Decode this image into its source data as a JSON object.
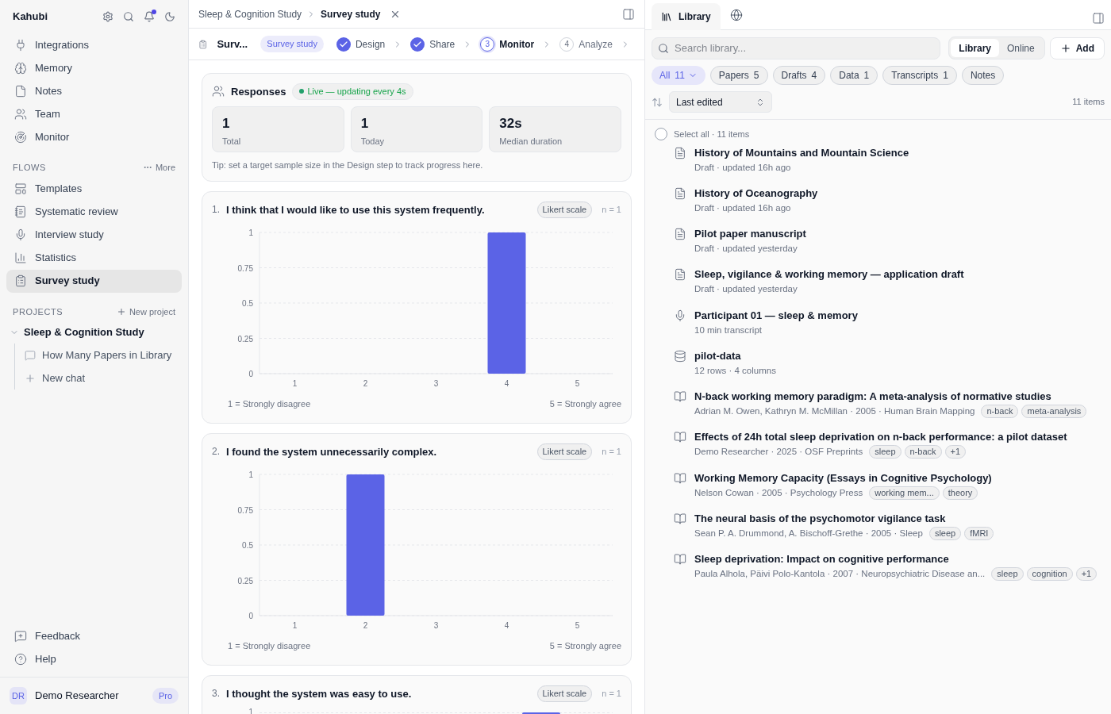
{
  "sidebar": {
    "brand": "Kahubi",
    "nav": [
      {
        "label": "Integrations",
        "selected": false
      },
      {
        "label": "Memory",
        "selected": false
      },
      {
        "label": "Notes",
        "selected": false
      },
      {
        "label": "Team",
        "selected": false
      },
      {
        "label": "Monitor",
        "selected": false
      }
    ],
    "flows_heading": "FLOWS",
    "flows_more": "More",
    "flows": [
      {
        "label": "Templates",
        "selected": false
      },
      {
        "label": "Systematic review",
        "selected": false
      },
      {
        "label": "Interview study",
        "selected": false
      },
      {
        "label": "Statistics",
        "selected": false
      },
      {
        "label": "Survey study",
        "selected": true
      }
    ],
    "projects_heading": "PROJECTS",
    "new_project": "New project",
    "projects": [
      {
        "label": "Sleep & Cognition Study",
        "expanded": true,
        "children": [
          {
            "label": "How Many Papers in Library",
            "kind": "chat"
          },
          {
            "label": "New chat",
            "kind": "new"
          }
        ]
      }
    ],
    "footer": [
      {
        "label": "Feedback"
      },
      {
        "label": "Help"
      }
    ],
    "user": {
      "initials": "DR",
      "name": "Demo Researcher",
      "plan": "Pro"
    }
  },
  "main": {
    "breadcrumb": [
      "Sleep & Cognition Study",
      "Survey study"
    ],
    "study_title": "Surv...",
    "study_badge": "Survey study",
    "steps": [
      {
        "label": "Design",
        "checked": true,
        "selected": false
      },
      {
        "label": "Share",
        "checked": true,
        "selected": false
      },
      {
        "number": "3",
        "label": "Monitor",
        "checked": false,
        "selected": true
      },
      {
        "number": "4",
        "label": "Analyze",
        "checked": false,
        "selected": false
      }
    ],
    "responses": {
      "title": "Responses",
      "live": "Live — updating every 4s",
      "stats": [
        {
          "value": "1",
          "label": "Total"
        },
        {
          "value": "1",
          "label": "Today"
        },
        {
          "value": "32s",
          "label": "Median duration"
        }
      ],
      "tip": "Tip: set a target sample size in the Design step to track progress here."
    },
    "questions": [
      {
        "number": "1.",
        "text": "I think that I would like to use this system frequently.",
        "badge": "Likert scale",
        "n": "n = 1",
        "low_label": "1 = Strongly disagree",
        "high_label": "5 = Strongly agree",
        "chart_data": {
          "type": "bar",
          "categories": [
            "1",
            "2",
            "3",
            "4",
            "5"
          ],
          "values": [
            0,
            0,
            0,
            1,
            0
          ],
          "ylim": [
            0,
            1
          ],
          "yticks": [
            0,
            0.25,
            0.5,
            0.75,
            1
          ],
          "grid": true
        }
      },
      {
        "number": "2.",
        "text": "I found the system unnecessarily complex.",
        "badge": "Likert scale",
        "n": "n = 1",
        "low_label": "1 = Strongly disagree",
        "high_label": "5 = Strongly agree",
        "chart_data": {
          "type": "bar",
          "categories": [
            "1",
            "2",
            "3",
            "4",
            "5"
          ],
          "values": [
            0,
            1,
            0,
            0,
            0
          ],
          "ylim": [
            0,
            1
          ],
          "yticks": [
            0,
            0.25,
            0.5,
            0.75,
            1
          ],
          "grid": true
        }
      },
      {
        "number": "3.",
        "text": "I thought the system was easy to use.",
        "badge": "Likert scale",
        "n": "n = 1",
        "axis_label": "1"
      }
    ]
  },
  "library": {
    "tab": "Library",
    "search_placeholder": "Search library...",
    "modes": [
      {
        "label": "Library",
        "selected": true
      },
      {
        "label": "Online",
        "selected": false
      }
    ],
    "add": "Add",
    "filters": [
      {
        "label": "All",
        "count": "11",
        "selected": true
      },
      {
        "label": "Papers",
        "count": "5",
        "selected": false
      },
      {
        "label": "Drafts",
        "count": "4",
        "selected": false
      },
      {
        "label": "Data",
        "count": "1",
        "selected": false
      },
      {
        "label": "Transcripts",
        "count": "1",
        "selected": false
      },
      {
        "label": "Notes",
        "selected": false
      }
    ],
    "sort": "Last edited",
    "count": "11 items",
    "select_all": {
      "label": "Select all · 11 items",
      "checked": false
    },
    "items": [
      {
        "kind": "draft",
        "title": "History of Mountains and Mountain Science",
        "meta": "Draft · updated 16h ago"
      },
      {
        "kind": "draft",
        "title": "History of Oceanography",
        "meta": "Draft · updated 16h ago"
      },
      {
        "kind": "draft",
        "title": "Pilot paper manuscript",
        "meta": "Draft · updated yesterday"
      },
      {
        "kind": "draft",
        "title": "Sleep, vigilance & working memory — application draft",
        "meta": "Draft · updated yesterday"
      },
      {
        "kind": "transcript",
        "title": "Participant 01 — sleep & memory",
        "meta": "10 min transcript"
      },
      {
        "kind": "data",
        "title": "pilot-data",
        "meta": "12 rows · 4 columns"
      },
      {
        "kind": "paper",
        "title": "N-back working memory paradigm: A meta-analysis of normative studies",
        "meta": "Adrian M. Owen, Kathryn M. McMillan · 2005 · Human Brain Mapping",
        "tags": [
          "n-back",
          "meta-analysis"
        ]
      },
      {
        "kind": "paper",
        "title": "Effects of 24h total sleep deprivation on n-back performance: a pilot dataset",
        "meta": "Demo Researcher · 2025 · OSF Preprints",
        "tags": [
          "sleep",
          "n-back",
          "+1"
        ]
      },
      {
        "kind": "paper",
        "title": "Working Memory Capacity (Essays in Cognitive Psychology)",
        "meta": "Nelson Cowan · 2005 · Psychology Press",
        "tags": [
          "working mem...",
          "theory"
        ]
      },
      {
        "kind": "paper",
        "title": "The neural basis of the psychomotor vigilance task",
        "meta": "Sean P. A. Drummond, A. Bischoff-Grethe · 2005 · Sleep",
        "tags": [
          "sleep",
          "fMRI"
        ]
      },
      {
        "kind": "paper",
        "title": "Sleep deprivation: Impact on cognitive performance",
        "meta": "Paula Alhola, Päivi Polo-Kantola · 2007 · Neuropsychiatric Disease an...",
        "tags": [
          "sleep",
          "cognition",
          "+1"
        ]
      }
    ]
  }
}
